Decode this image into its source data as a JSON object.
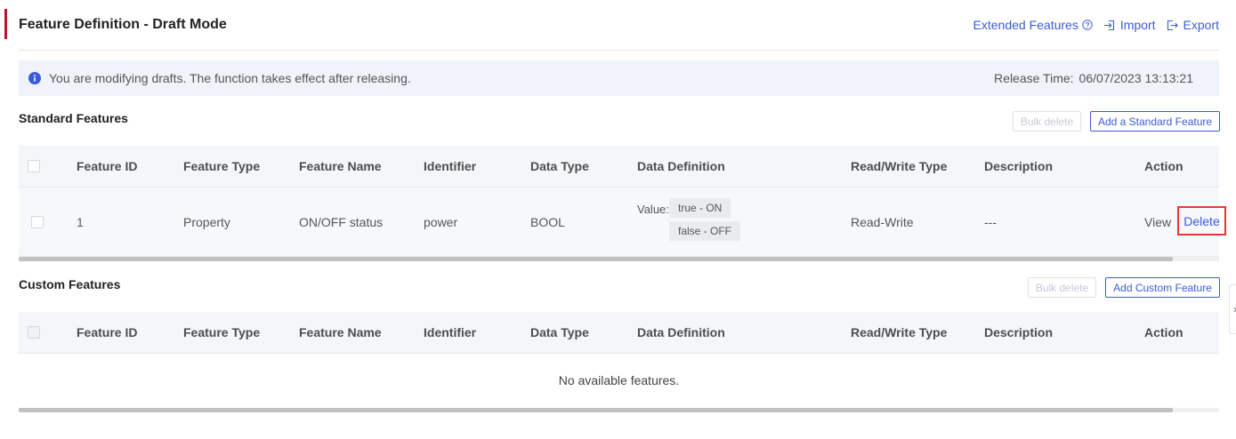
{
  "header": {
    "title": "Feature Definition - Draft Mode",
    "actions": {
      "extended_label": "Extended Features",
      "import_label": "Import",
      "export_label": "Export"
    }
  },
  "notice": {
    "text": "You are modifying drafts. The function takes effect after releasing.",
    "release_label": "Release Time:",
    "release_time": "06/07/2023 13:13:21"
  },
  "columns": {
    "feature_id": "Feature ID",
    "feature_type": "Feature Type",
    "feature_name": "Feature Name",
    "identifier": "Identifier",
    "data_type": "Data Type",
    "data_definition": "Data Definition",
    "rw_type": "Read/Write Type",
    "description": "Description",
    "action": "Action"
  },
  "standard": {
    "title": "Standard Features",
    "bulk_delete_label": "Bulk delete",
    "add_label": "Add a Standard Feature",
    "rows": [
      {
        "feature_id": "1",
        "feature_type": "Property",
        "feature_name": "ON/OFF status",
        "identifier": "power",
        "data_type": "BOOL",
        "data_def_label": "Value:",
        "data_def_values": [
          "true - ON",
          "false - OFF"
        ],
        "rw_type": "Read-Write",
        "description": "---",
        "view_label": "View",
        "delete_label": "Delete"
      }
    ]
  },
  "custom": {
    "title": "Custom Features",
    "bulk_delete_label": "Bulk delete",
    "add_label": "Add Custom Feature",
    "empty_text": "No available features."
  },
  "colors": {
    "accent_red": "#c8102e",
    "link_blue": "#3a5bd9",
    "highlight_red": "#e53935"
  },
  "icons": {
    "extended": "help-circle-icon",
    "import": "import-icon",
    "export": "export-icon",
    "notice": "info-icon",
    "side_tab": "chevron-right-icon"
  }
}
